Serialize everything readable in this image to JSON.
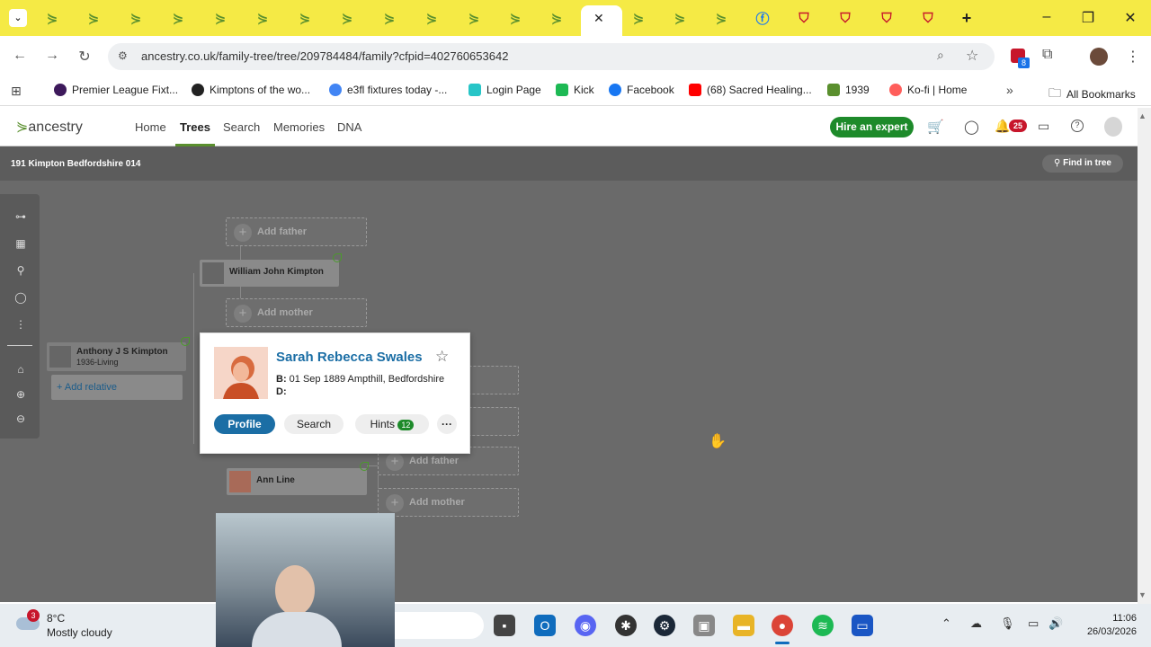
{
  "browser": {
    "url": "ancestry.co.uk/family-tree/tree/209784484/family?cfpid=402760653642",
    "extensions_badge": "8",
    "bookmarks": [
      {
        "label": "Premier League Fixt...",
        "color": "#3d195b"
      },
      {
        "label": "Kimptons of the wo...",
        "color": "#222"
      },
      {
        "label": "e3fl fixtures today -...",
        "color": "#4285f4"
      },
      {
        "label": "Login Page",
        "color": "#27c5c7"
      },
      {
        "label": "Kick",
        "color": "#1db954"
      },
      {
        "label": "Facebook",
        "color": "#1877f2"
      },
      {
        "label": "(68) Sacred Healing...",
        "color": "#ff0000"
      },
      {
        "label": "1939",
        "color": "#5a8f2e"
      },
      {
        "label": "Ko-fi | Home",
        "color": "#ff5e5b"
      }
    ],
    "all_bookmarks": "All Bookmarks"
  },
  "ancestry": {
    "logo": "ancestry",
    "nav": [
      "Home",
      "Trees",
      "Search",
      "Memories",
      "DNA"
    ],
    "hire": "Hire an expert",
    "notif_count": "25"
  },
  "tree": {
    "title": "191 Kimpton Bedfordshire 014",
    "find": "Find in tree",
    "add_father": "Add father",
    "add_mother": "Add mother",
    "father_name": "William John Kimpton",
    "root_name": "Anthony J S Kimpton",
    "root_dates": "1936-Living",
    "add_relative": "Add relative",
    "ann_name": "Ann Line"
  },
  "popup": {
    "name": "Sarah Rebecca Swales",
    "birth_label": "B:",
    "birth": "01 Sep 1889 Ampthill, Bedfordshire",
    "death_label": "D:",
    "profile": "Profile",
    "search": "Search",
    "hints": "Hints",
    "hints_count": "12"
  },
  "taskbar": {
    "weather_badge": "3",
    "temp": "8°C",
    "weather": "Mostly cloudy",
    "time": "11:06",
    "date": "26/03/2026"
  }
}
